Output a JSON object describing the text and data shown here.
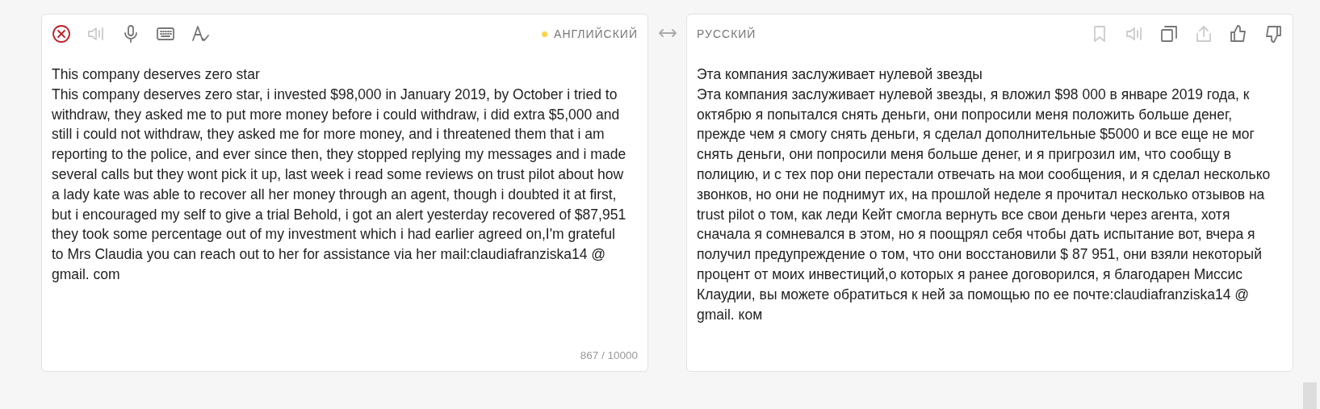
{
  "source": {
    "tools": [
      {
        "kind": "clear",
        "disabled": false
      },
      {
        "kind": "speaker",
        "disabled": true
      },
      {
        "kind": "microphone",
        "disabled": false
      },
      {
        "kind": "keyboard",
        "disabled": false
      },
      {
        "kind": "spellcheck",
        "disabled": false
      }
    ],
    "language": "АНГЛИЙСКИЙ",
    "detected": true,
    "text": [
      "This company deserves zero star",
      "This company deserves zero star, i invested $98,000 in January 2019, by October i tried to withdraw, they asked me to put more money before i could withdraw, i did extra $5,000 and still i could not withdraw, they asked me for more money, and i threatened them that i am reporting to the police, and ever since then, they stopped replying my messages and i made several calls but they wont pick it up, last week i read some reviews on trust pilot about how a lady kate was able to recover all her money through an agent, though i doubted it at first, but i encouraged my self to give a trial Behold, i got an alert yesterday recovered of $87,951 they took some percentage out of my investment which i had earlier agreed on,I'm grateful to Mrs Claudia you can reach out to her for assistance via her mail:claudiafranziska14 @ gmail. com"
    ],
    "counter": "867 / 10000"
  },
  "target": {
    "language": "РУССКИЙ",
    "tools": [
      {
        "kind": "bookmark",
        "disabled": true
      },
      {
        "kind": "speaker",
        "disabled": true
      },
      {
        "kind": "copy",
        "disabled": false
      },
      {
        "kind": "share",
        "disabled": true
      },
      {
        "kind": "like",
        "disabled": false
      },
      {
        "kind": "dislike",
        "disabled": false
      }
    ],
    "text": [
      "Эта компания заслуживает нулевой звезды",
      "Эта компания заслуживает нулевой звезды, я вложил $98 000 в январе 2019 года, к октябрю я попытался снять деньги, они попросили меня положить больше денег, прежде чем я смогу снять деньги, я сделал дополнительные $5000 и все еще не мог снять деньги, они попросили меня больше денег, и я пригрозил им, что сообщу в полицию, и с тех пор они перестали отвечать на мои сообщения, и я сделал несколько звонков, но они не поднимут их, на прошлой неделе я прочитал несколько отзывов на trust pilot о том, как леди Кейт смогла вернуть все свои деньги через агента, хотя сначала я сомневался в этом, но я поощрял себя чтобы дать испытание вот, вчера я получил предупреждение о том, что они восстановили $ 87 951, они взяли некоторый процент от моих инвестиций,о которых я ранее договорился, я благодарен Миссис Клаудии, вы можете обратиться к ней за помощью по ее почте:claudiafranziska14 @ gmail. ком"
    ]
  }
}
